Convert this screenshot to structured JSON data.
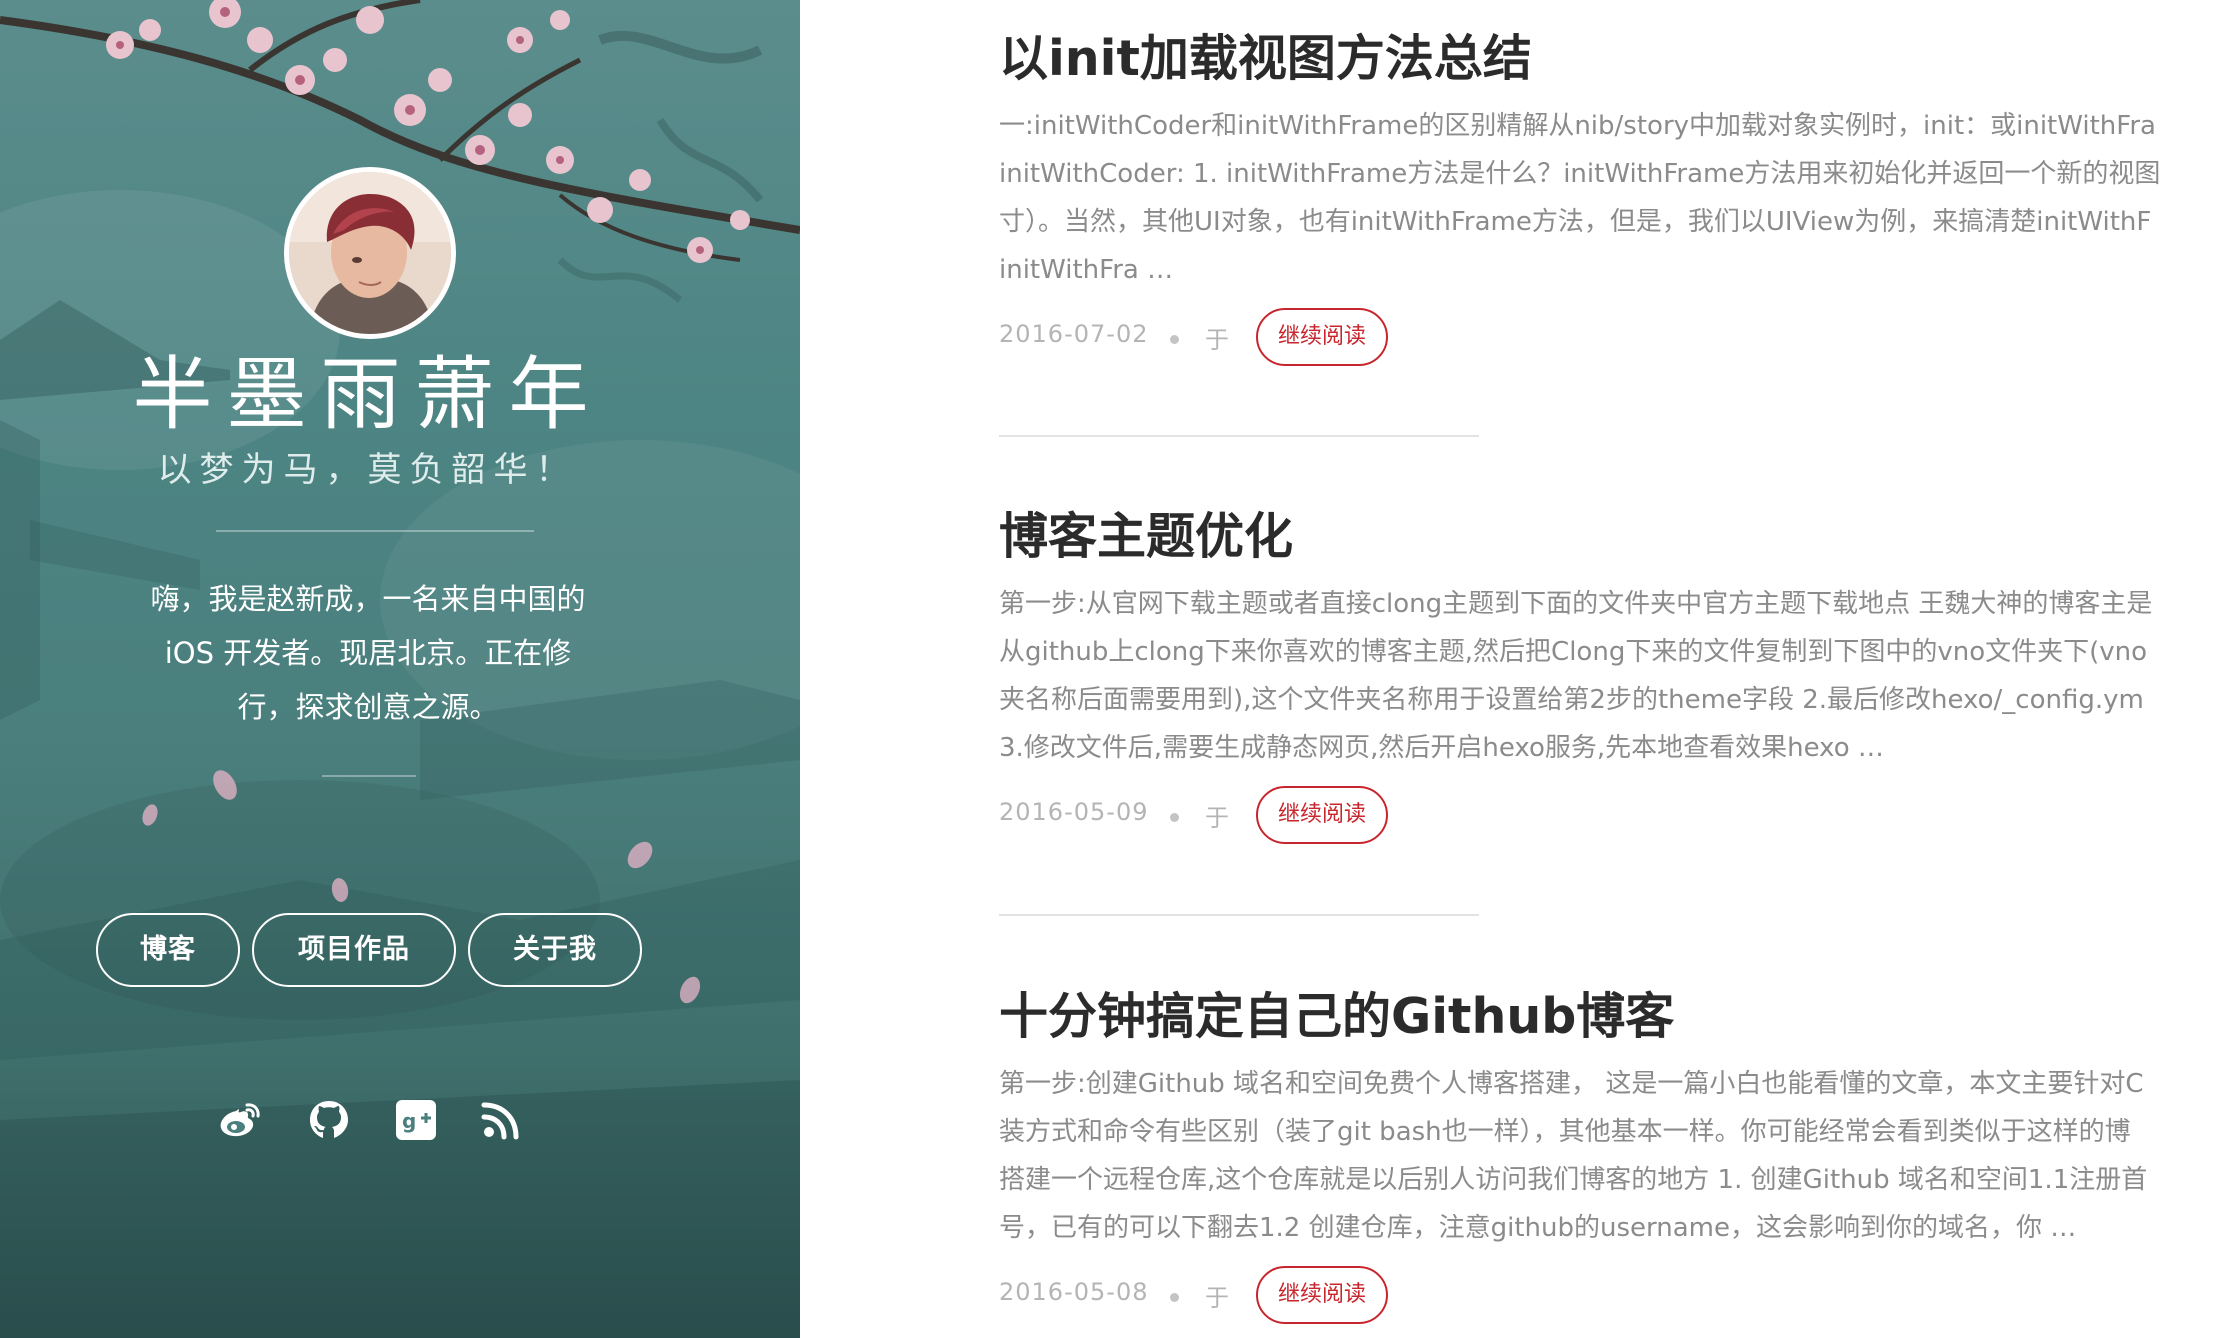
{
  "sidebar": {
    "title": "半墨雨萧年",
    "subtitle": "以梦为马，莫负韶华！",
    "bio_lines": [
      "嗨，我是赵新成，一名来自中国的",
      "iOS 开发者。现居北京。正在修",
      "行，探求创意之源。"
    ],
    "nav": [
      {
        "label": "博客"
      },
      {
        "label": "项目作品"
      },
      {
        "label": "关于我"
      }
    ],
    "social_icons": [
      "weibo-icon",
      "github-icon",
      "google-plus-icon",
      "rss-icon"
    ]
  },
  "posts": [
    {
      "title": "以init加载视图方法总结",
      "excerpt_lines": [
        "一:initWithCoder和initWithFrame的区别精解从nib/story中加载对象实例时，init：或initWithFra",
        "initWithCoder: 1. initWithFrame方法是什么？initWithFrame方法用来初始化并返回一个新的视图",
        "寸）。当然，其他UI对象，也有initWithFrame方法，但是，我们以UIView为例，来搞清楚initWithF",
        "initWithFra …"
      ],
      "date": "2016-07-02",
      "at": "于",
      "read_more": "继续阅读"
    },
    {
      "title": "博客主题优化",
      "excerpt_lines": [
        "第一步:从官网下载主题或者直接clong主题到下面的文件夹中官方主题下载地点 王魏大神的博客主是",
        "从github上clong下来你喜欢的博客主题,然后把Clong下来的文件复制到下图中的vno文件夹下(vno",
        "夹名称后面需要用到),这个文件夹名称用于设置给第2步的theme字段 2.最后修改hexo/_config.ym",
        "3.修改文件后,需要生成静态网页,然后开启hexo服务,先本地查看效果hexo …"
      ],
      "date": "2016-05-09",
      "at": "于",
      "read_more": "继续阅读"
    },
    {
      "title": "十分钟搞定自己的Github博客",
      "excerpt_lines": [
        "第一步:创建Github 域名和空间免费个人博客搭建， 这是一篇小白也能看懂的文章，本文主要针对C",
        "装方式和命令有些区别（装了git bash也一样），其他基本一样。你可能经常会看到类似于这样的博",
        "搭建一个远程仓库,这个仓库就是以后别人访问我们博客的地方 1. 创建Github 域名和空间1.1注册首",
        "号，已有的可以下翻去1.2 创建仓库，注意github的username，这会影响到你的域名，你 …"
      ],
      "date": "2016-05-08",
      "at": "于",
      "read_more": "继续阅读"
    }
  ],
  "colors": {
    "sidebar_teal": "#4d8584",
    "accent_red": "#c8262d",
    "title_text": "#2b2b2b",
    "excerpt_text": "#8b8b8b"
  }
}
